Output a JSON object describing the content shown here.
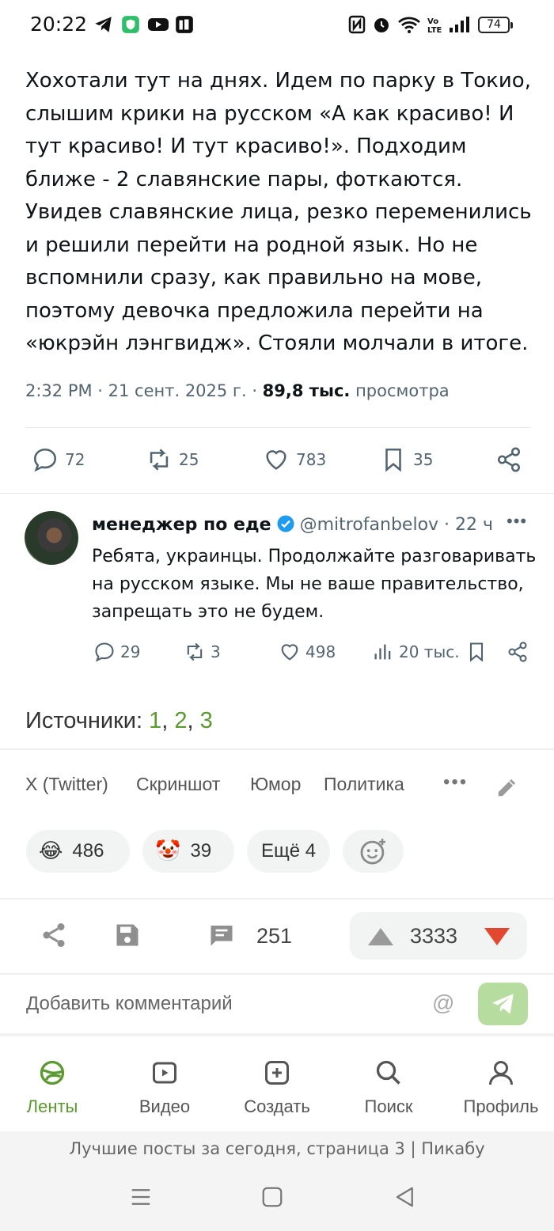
{
  "status_bar": {
    "time": "20:22",
    "battery": "74"
  },
  "tweet": {
    "text": "Хохотали тут на днях. Идем по парку в Токио, слышим крики на русском «А как красиво! И тут красиво! И тут красиво!». Подходим ближе - 2 славянские пары, фоткаются. Увидев славянские лица, резко переменились и решили перейти на родной язык. Но не вспомнили сразу, как правильно на мове, поэтому девочка предложила перейти на «юкрэйн лэнгвидж». Стояли молчали в итоге.",
    "meta_time": "2:32 PM · 21 сент. 2025 г. · ",
    "views_value": "89,8 тыс.",
    "views_label": "просмотра",
    "replies": "72",
    "retweets": "25",
    "likes": "783",
    "bookmarks": "35"
  },
  "reply": {
    "name": "менеджер по еде",
    "handle": "@mitrofanbelov · 22 ч",
    "more": "•••",
    "text": "Ребята, украинцы. Продолжайте разговаривать на русском языке. Мы не ваше правительство, запрещать это не будем.",
    "replies": "29",
    "retweets": "3",
    "likes": "498",
    "views": "20 тыс."
  },
  "sources": {
    "label": "Источники: ",
    "links": [
      "1",
      "2",
      "3"
    ],
    "sep": ", "
  },
  "tags": [
    "X (Twitter)",
    "Скриншот",
    "Юмор",
    "Политика"
  ],
  "tags_more": "•••",
  "reactions": [
    {
      "emoji": "😂",
      "count": "486"
    },
    {
      "emoji": "🤡",
      "count": "39"
    },
    {
      "label": "Ещё 4"
    }
  ],
  "actions": {
    "comments": "251",
    "rating": "3333"
  },
  "comment_box": {
    "placeholder": "Добавить комментарий",
    "at": "@"
  },
  "nav": [
    {
      "label": "Ленты",
      "icon": "feeds-icon"
    },
    {
      "label": "Видео",
      "icon": "video-icon"
    },
    {
      "label": "Создать",
      "icon": "create-icon"
    },
    {
      "label": "Поиск",
      "icon": "search-icon"
    },
    {
      "label": "Профиль",
      "icon": "profile-icon"
    }
  ],
  "footer_title": "Лучшие посты за сегодня, страница 3 | Пикабу",
  "colors": {
    "accent": "#5a9a2e",
    "downvote": "#e2482f",
    "send": "#b7dc9f"
  }
}
